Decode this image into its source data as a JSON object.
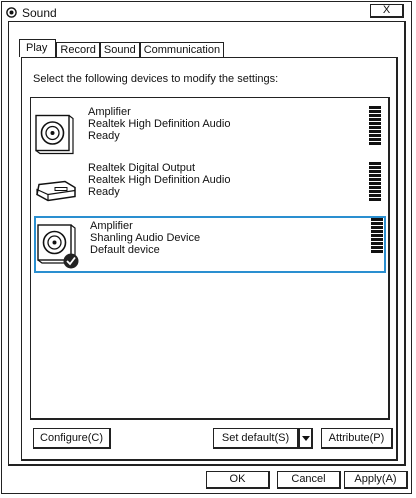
{
  "window": {
    "title": "Sound",
    "close_label": "X"
  },
  "tabs": [
    {
      "label": "Play",
      "active": true
    },
    {
      "label": "Record",
      "active": false
    },
    {
      "label": "Sound",
      "active": false
    },
    {
      "label": "Communication",
      "active": false
    }
  ],
  "instruction": "Select the following devices to modify the settings:",
  "devices": [
    {
      "line1": "Amplifier",
      "line2": "Realtek High Definition Audio",
      "line3": "Ready",
      "icon": "speaker-icon",
      "selected": false
    },
    {
      "line1": "Realtek Digital Output",
      "line2": "Realtek High Definition Audio",
      "line3": "Ready",
      "icon": "digital-output-icon",
      "selected": false
    },
    {
      "line1": "Amplifier",
      "line2": "Shanling Audio Device",
      "line3": "Default device",
      "icon": "speaker-default-icon",
      "selected": true
    }
  ],
  "buttons": {
    "configure": "Configure(C)",
    "set_default": "Set default(S)",
    "attribute": "Attribute(P)",
    "ok": "OK",
    "cancel": "Cancel",
    "apply": "Apply(A)"
  },
  "colors": {
    "selection_border": "#2a8fd0"
  }
}
